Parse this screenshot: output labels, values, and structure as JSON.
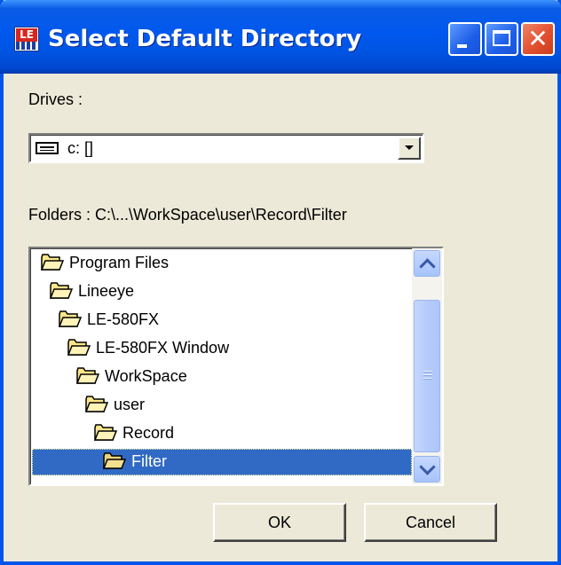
{
  "window": {
    "title": "Select Default Directory",
    "app_icon_text": "LE"
  },
  "titlebar_buttons": [
    "minimize",
    "maximize",
    "close"
  ],
  "drives": {
    "label": "Drives :",
    "selected": "c: []",
    "icon": "drive-icon"
  },
  "folders": {
    "label": "Folders :  C:\\...\\WorkSpace\\user\\Record\\Filter",
    "items": [
      {
        "label": "Program Files",
        "depth": 0,
        "selected": false
      },
      {
        "label": "Lineeye",
        "depth": 1,
        "selected": false
      },
      {
        "label": "LE-580FX",
        "depth": 2,
        "selected": false
      },
      {
        "label": "LE-580FX Window",
        "depth": 3,
        "selected": false
      },
      {
        "label": "WorkSpace",
        "depth": 4,
        "selected": false
      },
      {
        "label": "user",
        "depth": 5,
        "selected": false
      },
      {
        "label": "Record",
        "depth": 6,
        "selected": false
      },
      {
        "label": "Filter",
        "depth": 7,
        "selected": true
      }
    ]
  },
  "buttons": {
    "ok": "OK",
    "cancel": "Cancel"
  },
  "colors": {
    "titlebar": "#0054e3",
    "selection": "#316ac5",
    "dialog_bg": "#ece9d8",
    "folder_fill": "#ffe68a"
  }
}
